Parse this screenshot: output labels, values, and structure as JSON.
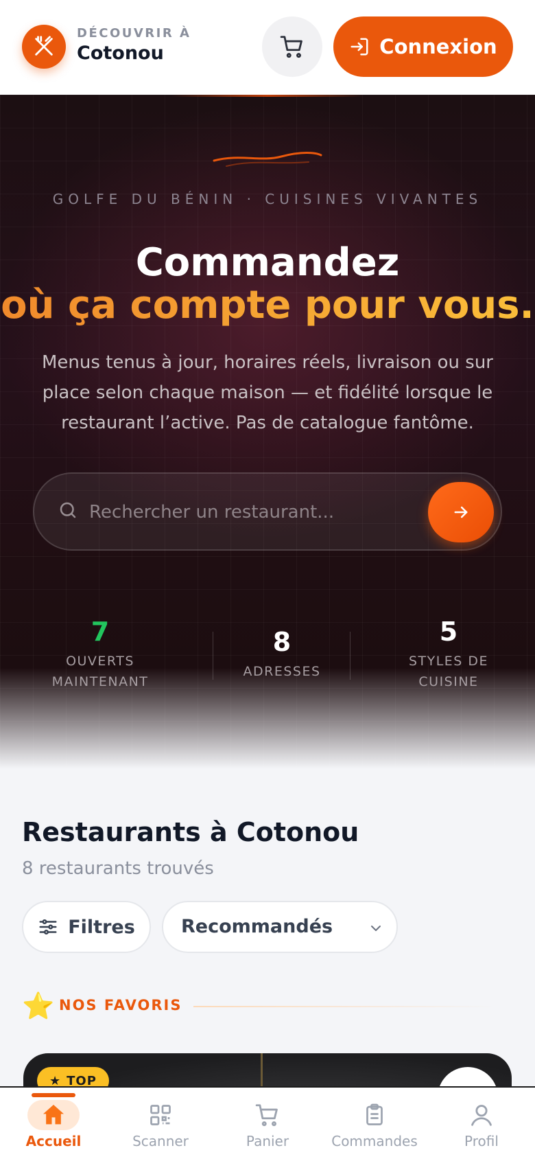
{
  "header": {
    "subtitle": "DÉCOUVRIR À",
    "city": "Cotonou",
    "login_label": "Connexion"
  },
  "hero": {
    "eyebrow": "GOLFE DU BÉNIN · CUISINES VIVANTES",
    "title_line1": "Commandez",
    "title_line2": "où ça compte pour vous.",
    "description": "Menus tenus à jour, horaires réels, livraison ou sur place selon chaque maison — et fidélité lorsque le restaurant l’active. Pas de catalogue fantôme.",
    "search_placeholder": "Rechercher un restaurant...",
    "stats": [
      {
        "value": "7",
        "label_line1": "OUVERTS",
        "label_line2": "MAINTENANT",
        "color": "#22c55e"
      },
      {
        "value": "8",
        "label_line1": "ADRESSES",
        "label_line2": ""
      },
      {
        "value": "5",
        "label_line1": "STYLES DE",
        "label_line2": "CUISINE"
      }
    ]
  },
  "section": {
    "title": "Restaurants à Cotonou",
    "count_text": "8 restaurants trouvés",
    "filters_label": "Filtres",
    "sort_selected": "Recommandés",
    "favorites_label": "NOS FAVORIS"
  },
  "card": {
    "badge": "TOP"
  },
  "nav": {
    "items": [
      {
        "label": "Accueil",
        "icon": "home-icon",
        "active": true
      },
      {
        "label": "Scanner",
        "icon": "qr-scan-icon"
      },
      {
        "label": "Panier",
        "icon": "cart-icon"
      },
      {
        "label": "Commandes",
        "icon": "clipboard-icon"
      },
      {
        "label": "Profil",
        "icon": "user-icon"
      }
    ]
  },
  "colors": {
    "accent": "#ea580c",
    "open_green": "#22c55e",
    "star": "#fbbf24"
  }
}
